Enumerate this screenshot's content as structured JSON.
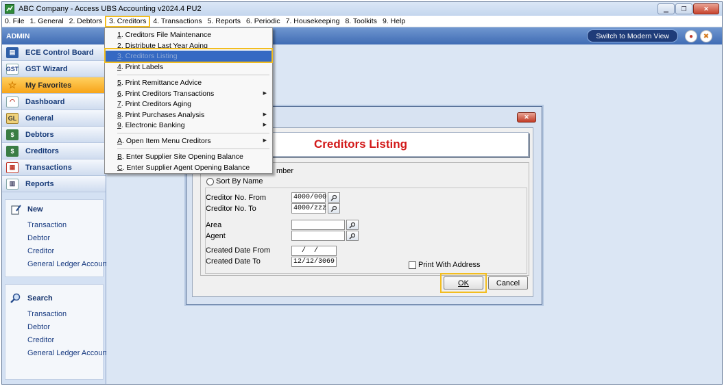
{
  "window": {
    "title": "ABC Company - Access UBS Accounting v2024.4 PU2"
  },
  "menubar": {
    "items": [
      "0. File",
      "1. General",
      "2. Debtors",
      "3. Creditors",
      "4. Transactions",
      "5. Reports",
      "6. Periodic",
      "7. Housekeeping",
      "8. Toolkits",
      "9. Help"
    ],
    "active_index": 3
  },
  "userbar": {
    "user": "ADMIN",
    "modern_view": "Switch to Modern View"
  },
  "sidebar": {
    "nav": [
      {
        "label": "ECE Control Board",
        "icon": "control-board-icon"
      },
      {
        "label": "GST Wizard",
        "icon": "gst-icon"
      },
      {
        "label": "My Favorites",
        "icon": "star-icon"
      },
      {
        "label": "Dashboard",
        "icon": "dashboard-icon"
      },
      {
        "label": "General",
        "icon": "gl-icon"
      },
      {
        "label": "Debtors",
        "icon": "debtors-icon"
      },
      {
        "label": "Creditors",
        "icon": "creditors-icon"
      },
      {
        "label": "Transactions",
        "icon": "transactions-icon"
      },
      {
        "label": "Reports",
        "icon": "reports-icon"
      }
    ],
    "new_panel": {
      "title": "New",
      "links": [
        "Transaction",
        "Debtor",
        "Creditor",
        "General Ledger Account"
      ]
    },
    "search_panel": {
      "title": "Search",
      "links": [
        "Transaction",
        "Debtor",
        "Creditor",
        "General Ledger Account"
      ]
    }
  },
  "dropdown": {
    "items": [
      {
        "key": "1",
        "rest": ". Creditors File Maintenance",
        "submenu": false
      },
      {
        "key": "2",
        "rest": ". Distribute Last Year Aging",
        "submenu": false
      },
      {
        "key": "3",
        "rest": ". Creditors Listing",
        "submenu": false,
        "highlighted": true
      },
      {
        "key": "4",
        "rest": ". Print Labels",
        "submenu": false
      },
      {
        "key": "5",
        "rest": ". Print Remittance Advice",
        "submenu": false
      },
      {
        "key": "6",
        "rest": ". Print Creditors Transactions",
        "submenu": true
      },
      {
        "key": "7",
        "rest": ". Print Creditors Aging",
        "submenu": false
      },
      {
        "key": "8",
        "rest": ". Print Purchases Analysis",
        "submenu": true
      },
      {
        "key": "9",
        "rest": ". Electronic Banking",
        "submenu": true
      },
      {
        "key": "A",
        "rest": ". Open Item Menu Creditors",
        "submenu": true
      },
      {
        "key": "B",
        "rest": ". Enter Supplier Site Opening Balance",
        "submenu": false
      },
      {
        "key": "C",
        "rest": ". Enter Supplier Agent Opening Balance",
        "submenu": false
      }
    ]
  },
  "dialog": {
    "title": "Creditors Listing",
    "sort_by_number_visible": "mber",
    "sort_by_name": "Sort By Name",
    "fields": {
      "creditor_from": {
        "label": "Creditor No. From",
        "value": "4000/000"
      },
      "creditor_to": {
        "label": "Creditor No. To",
        "value": "4000/zzz"
      },
      "area": {
        "label": "Area",
        "value": ""
      },
      "agent": {
        "label": "Agent",
        "value": ""
      },
      "created_from": {
        "label": "Created Date From",
        "value": "  /  /"
      },
      "created_to": {
        "label": "Created Date To",
        "value": "12/12/3069"
      }
    },
    "print_with_address": "Print With Address",
    "ok": "OK",
    "cancel": "Cancel"
  },
  "colors": {
    "highlight_frame": "#f2bd1f",
    "dialog_title": "#d21818",
    "menu_selection": "#3569c3"
  }
}
